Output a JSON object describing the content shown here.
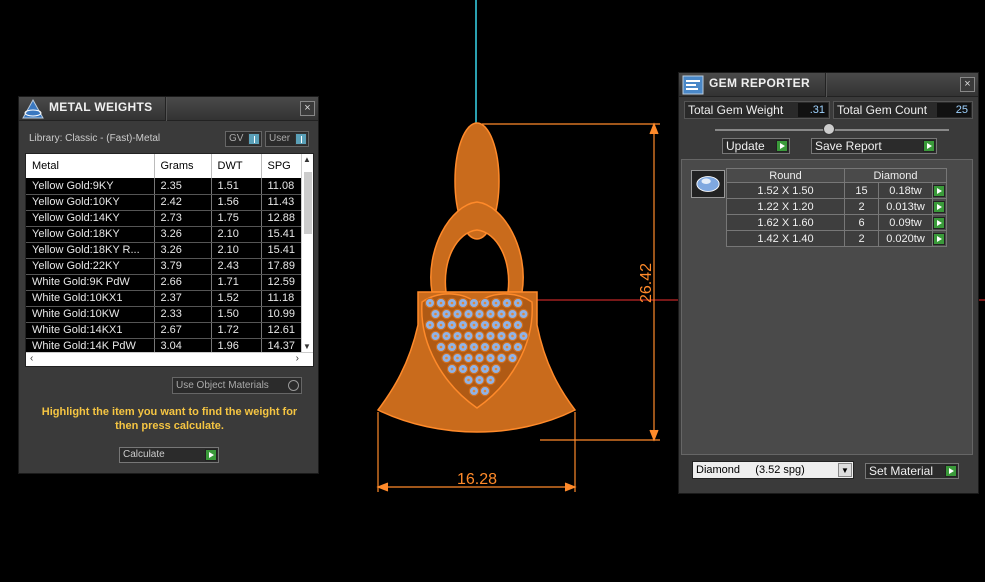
{
  "viewport": {
    "dim_height": "26.42",
    "dim_width": "16.28",
    "colors": {
      "metal": "#c96b1c",
      "outline": "#ff8a2a",
      "gem": "#8fb3e8",
      "axis_red": "#a02020",
      "axis_cyan": "#2aa0b0"
    }
  },
  "metal_panel": {
    "title": "METAL WEIGHTS",
    "library": "Library: Classic - (Fast)-Metal",
    "gv_label": "GV",
    "user_label": "User",
    "columns": [
      "Metal",
      "Grams",
      "DWT",
      "SPG"
    ],
    "rows": [
      [
        "Yellow Gold:9KY",
        "2.35",
        "1.51",
        "11.08"
      ],
      [
        "Yellow Gold:10KY",
        "2.42",
        "1.56",
        "11.43"
      ],
      [
        "Yellow Gold:14KY",
        "2.73",
        "1.75",
        "12.88"
      ],
      [
        "Yellow Gold:18KY",
        "3.26",
        "2.10",
        "15.41"
      ],
      [
        "Yellow Gold:18KY R...",
        "3.26",
        "2.10",
        "15.41"
      ],
      [
        "Yellow Gold:22KY",
        "3.79",
        "2.43",
        "17.89"
      ],
      [
        "White Gold:9K PdW",
        "2.66",
        "1.71",
        "12.59"
      ],
      [
        "White Gold:10KX1",
        "2.37",
        "1.52",
        "11.18"
      ],
      [
        "White Gold:10KW",
        "2.33",
        "1.50",
        "10.99"
      ],
      [
        "White Gold:14KX1",
        "2.67",
        "1.72",
        "12.61"
      ],
      [
        "White Gold:14K PdW",
        "3.04",
        "1.96",
        "14.37"
      ]
    ],
    "use_object_materials": "Use Object Materials",
    "highlight_message": "Highlight the item you want to find the weight for then press calculate.",
    "calculate_label": "Calculate",
    "close_symbol": "×"
  },
  "gem_panel": {
    "title": "GEM REPORTER",
    "total_weight_label": "Total Gem Weight",
    "total_weight_value": ".31",
    "total_count_label": "Total Gem Count",
    "total_count_value": "25",
    "update_label": "Update",
    "save_report_label": "Save Report",
    "headers": [
      "Round",
      "Diamond"
    ],
    "gems": [
      [
        "1.52 X 1.50",
        "15",
        "0.18tw"
      ],
      [
        "1.22 X 1.20",
        "2",
        "0.013tw"
      ],
      [
        "1.62 X 1.60",
        "6",
        "0.09tw"
      ],
      [
        "1.42 X 1.40",
        "2",
        "0.020tw"
      ]
    ],
    "material_select": "Diamond     (3.52 spg)",
    "set_material_label": "Set Material",
    "close_symbol": "×"
  }
}
